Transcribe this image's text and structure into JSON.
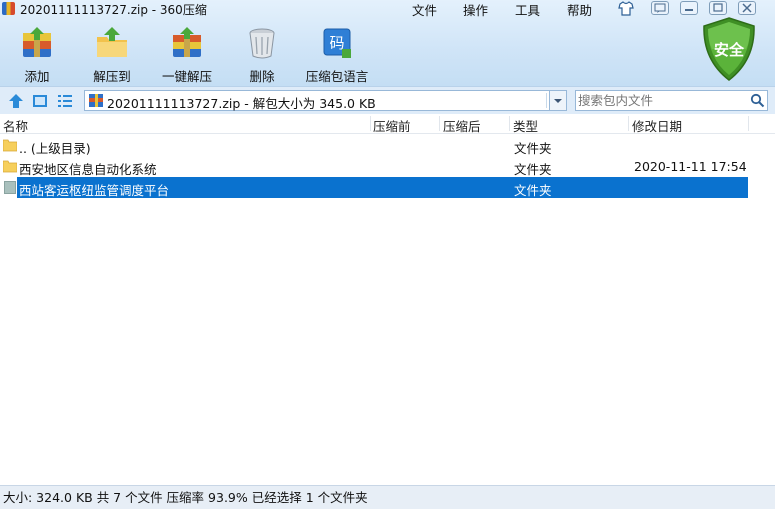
{
  "window": {
    "title": "20201111113727.zip - 360压缩",
    "menu": [
      "文件",
      "操作",
      "工具",
      "帮助"
    ]
  },
  "toolbar": {
    "add": "添加",
    "extract_to": "解压到",
    "one_click_extract": "一键解压",
    "delete": "删除",
    "language": "压缩包语言",
    "shield_text": "安全"
  },
  "address": {
    "path": "20201111113727.zip - 解包大小为 345.0 KB",
    "search_placeholder": "搜索包内文件"
  },
  "columns": [
    "名称",
    "压缩前",
    "压缩后",
    "类型",
    "修改日期"
  ],
  "rows": [
    {
      "name": ".. (上级目录)",
      "before": "",
      "after": "",
      "type": "文件夹",
      "date": "",
      "selected": false
    },
    {
      "name": "西安地区信息自动化系统",
      "before": "",
      "after": "",
      "type": "文件夹",
      "date": "2020-11-11 17:54",
      "selected": false
    },
    {
      "name": "西站客运枢纽监管调度平台",
      "before": "",
      "after": "",
      "type": "文件夹",
      "date": "",
      "selected": true
    }
  ],
  "status": "大小: 324.0 KB 共 7 个文件 压缩率 93.9% 已经选择 1 个文件夹",
  "colors": {
    "selection": "#0a72cf",
    "shield": "#4a9a2a",
    "folder": "#f6cf5c"
  }
}
